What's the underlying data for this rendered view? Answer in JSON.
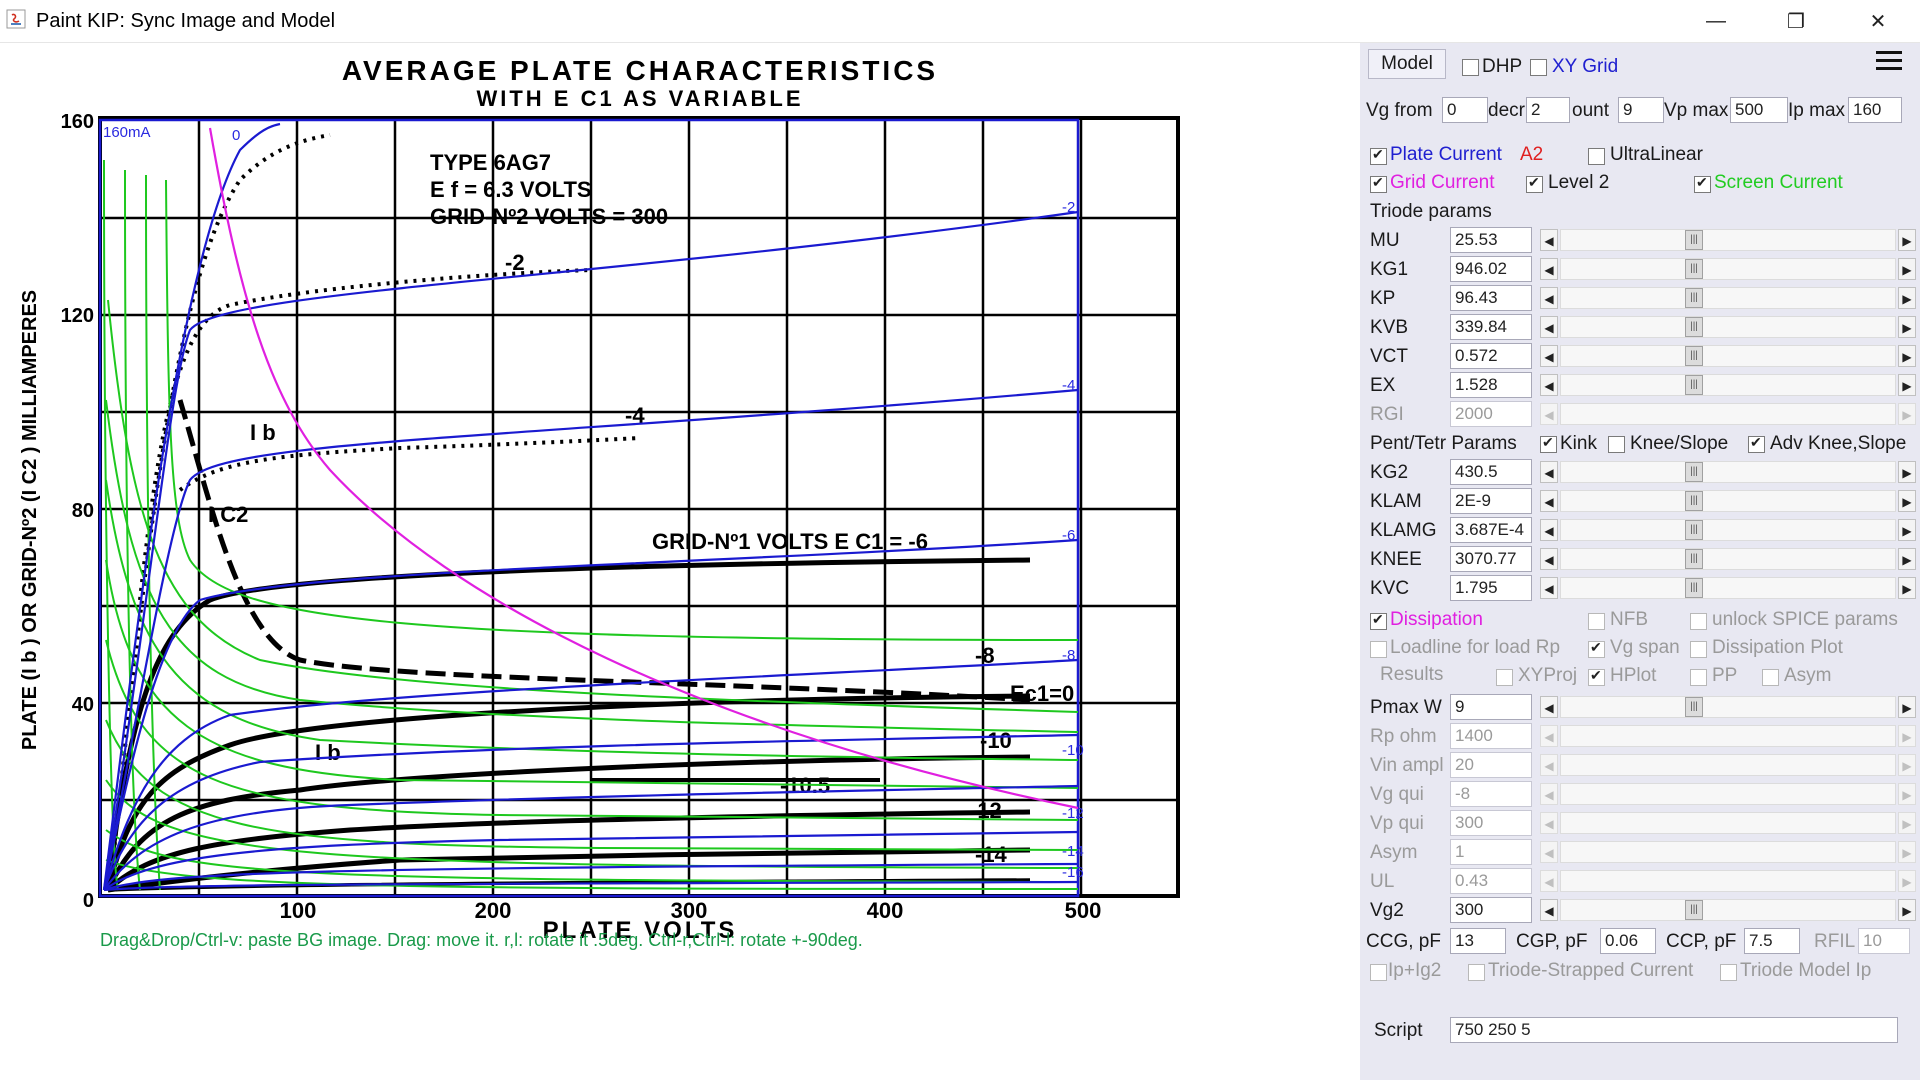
{
  "window": {
    "title": "Paint KIP: Sync Image and Model",
    "minimize": "—",
    "restore": "❐",
    "close": "✕"
  },
  "chart": {
    "title": "AVERAGE PLATE CHARACTERISTICS",
    "subtitle": "WITH E C1 AS VARIABLE",
    "tube": "TYPE 6AG7",
    "ef": "E f = 6.3 VOLTS",
    "grid2": "GRID-Nº2 VOLTS = 300",
    "grid1": "GRID-Nº1 VOLTS  E C1 = -6",
    "ylabel": "PLATE (I b ) OR GRID-Nº2 (I C2 ) MILLIAMPERES",
    "xlabel": "PLATE VOLTS",
    "xticks": [
      "100",
      "200",
      "300",
      "400",
      "500"
    ],
    "yticks": [
      "160",
      "120",
      "80",
      "40",
      "0"
    ],
    "curve_labels": [
      "-2",
      "-4",
      "-8",
      "-10",
      "-10.5",
      "-12",
      "-14",
      "Ec1=0"
    ],
    "ib_label": "I b",
    "ic2_label": "I C2",
    "corner_label": "160mA",
    "model_labels": [
      "0",
      "-2",
      "-4",
      "-6",
      "-8",
      "-10",
      "-12",
      "-14",
      "-16"
    ],
    "hint": "Drag&Drop/Ctrl-v: paste BG image. Drag: move it. r,l: rotate it .5deg. Ctrl-r,Ctrl-l: rotate +-90deg."
  },
  "panel": {
    "model_button": "Model",
    "dhp": "DHP",
    "xy_grid": "XY Grid",
    "vg_from_label": "Vg from",
    "vg_from": "0",
    "decr_label": "decr",
    "decr": "2",
    "count_label": "ount",
    "count": "9",
    "vpmax_label": "Vp max",
    "vpmax": "500",
    "ipmax_label": "Ip max",
    "ipmax": "160",
    "plate_current": "Plate Current",
    "a2": "A2",
    "ultralinear": "UltraLinear",
    "grid_current": "Grid Current",
    "level2": "Level 2",
    "screen_current": "Screen Current",
    "triode_params": "Triode params",
    "triode": [
      {
        "name": "MU",
        "value": "25.53"
      },
      {
        "name": "KG1",
        "value": "946.02"
      },
      {
        "name": "KP",
        "value": "96.43"
      },
      {
        "name": "KVB",
        "value": "339.84"
      },
      {
        "name": "VCT",
        "value": "0.572"
      },
      {
        "name": "EX",
        "value": "1.528"
      },
      {
        "name": "RGI",
        "value": "2000"
      }
    ],
    "pent_params": "Pent/Tetr Params",
    "kink": "Kink",
    "knee_slope": "Knee/Slope",
    "adv_knee": "Adv Knee,Slope",
    "pent": [
      {
        "name": "KG2",
        "value": "430.5"
      },
      {
        "name": "KLAM",
        "value": "2E-9"
      },
      {
        "name": "KLAMG",
        "value": "3.687E-4"
      },
      {
        "name": "KNEE",
        "value": "3070.77"
      },
      {
        "name": "KVC",
        "value": "1.795"
      }
    ],
    "dissipation": "Dissipation",
    "nfb": "NFB",
    "unlock_spice": "unlock SPICE params",
    "loadline": "Loadline for load Rp",
    "vg_span": "Vg span",
    "dissipation_plot": "Dissipation Plot",
    "results": "Results",
    "xyproj": "XYProj",
    "hplot": "HPlot",
    "pp": "PP",
    "asym": "Asym",
    "lower": [
      {
        "name": "Pmax W",
        "value": "9"
      },
      {
        "name": "Rp ohm",
        "value": "1400"
      },
      {
        "name": "Vin ampl",
        "value": "20"
      },
      {
        "name": "Vg qui",
        "value": "-8"
      },
      {
        "name": "Vp qui",
        "value": "300"
      },
      {
        "name": "Asym",
        "value": "1"
      },
      {
        "name": "UL",
        "value": "0.43"
      },
      {
        "name": "Vg2",
        "value": "300"
      }
    ],
    "ccg_label": "CCG, pF",
    "ccg": "13",
    "cgp_label": "CGP, pF",
    "cgp": "0.06",
    "ccp_label": "CCP, pF",
    "ccp": "7.5",
    "rfil_label": "RFIL",
    "rfil": "10",
    "iplg2": "Ip+Ig2",
    "triode_strapped": "Triode-Strapped Current",
    "triode_model_ip": "Triode Model Ip",
    "script_label": "Script",
    "script": "750 250 5"
  }
}
